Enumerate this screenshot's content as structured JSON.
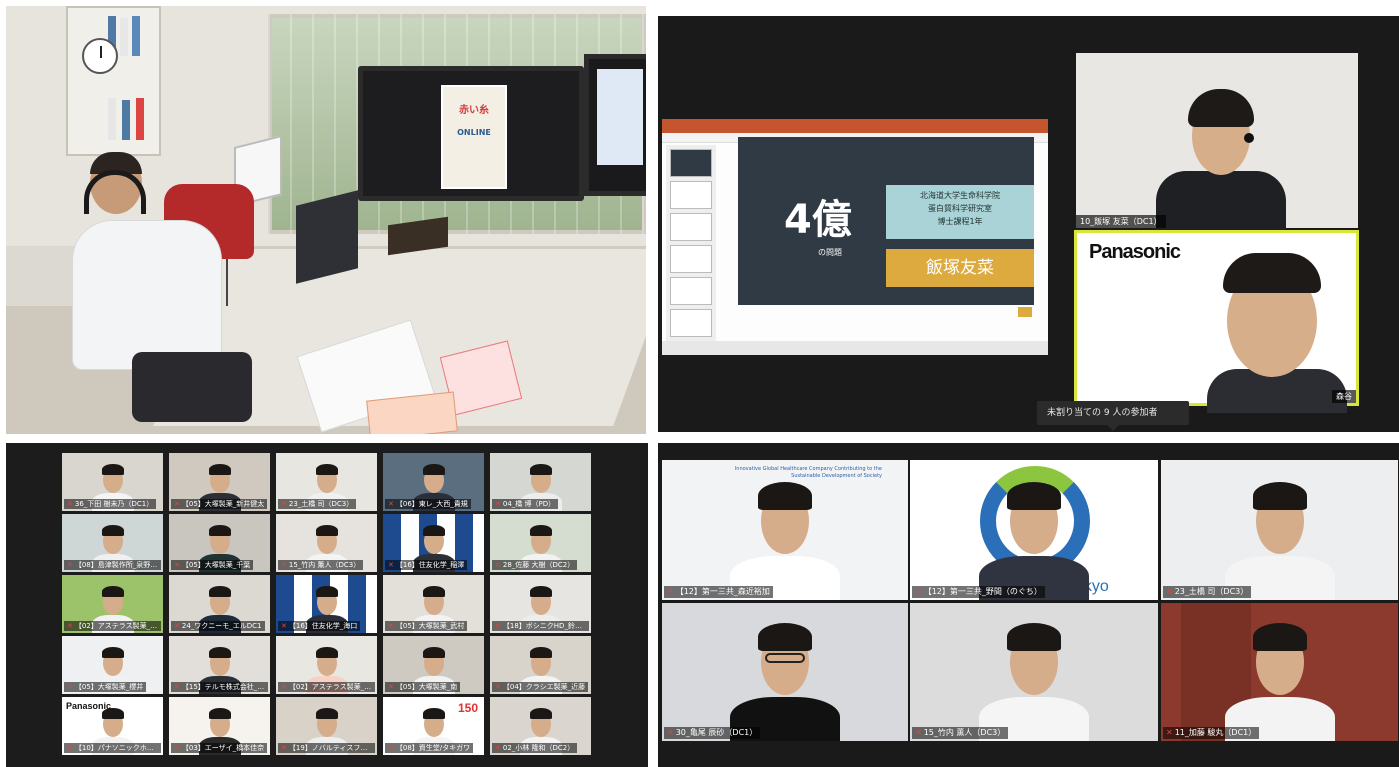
{
  "photo": {
    "poster_title": "赤い糸",
    "poster_sub": "ONLINE"
  },
  "meeting": {
    "slide": {
      "big_number": "4億",
      "big_unit": "",
      "subtitle": "の問題",
      "affiliation_lines": [
        "北海道大学生命科学院",
        "蛋白質科学研究室",
        "博士課程1年"
      ],
      "presenter": "飯塚友菜"
    },
    "video_tiles": [
      {
        "name_label": "10_飯塚 友菜（DC1）"
      },
      {
        "name_label": "森谷",
        "logo": "Panasonic"
      }
    ],
    "tooltip": "未割り当ての 9 人の参加者"
  },
  "grid_small": {
    "tiles": [
      {
        "label": "36_下田 樹未乃（DC1）"
      },
      {
        "label": "【05】大塚製薬_新井健太"
      },
      {
        "label": "23_土橋 司（DC3）"
      },
      {
        "label": "【06】東レ_大西_貴規"
      },
      {
        "label": "04_橋 博（PD）"
      },
      {
        "label": "【08】島津製作所_泉野美聡"
      },
      {
        "label": "【05】大塚製薬_千葉"
      },
      {
        "label": "15_竹内 薫人（DC3）"
      },
      {
        "label": "【16】住友化学_稲澤"
      },
      {
        "label": "28_佐藤 大樹（DC2）"
      },
      {
        "label": "【02】アステラス製薬_菅野"
      },
      {
        "label": "24_ワクニーモ_エルDC1"
      },
      {
        "label": "【16】住友化学_海口"
      },
      {
        "label": "【05】大塚製薬_武村"
      },
      {
        "label": "【18】ボシニクHD_鈴木 正明"
      },
      {
        "label": "【05】大塚製薬_櫻井"
      },
      {
        "label": "【15】テルモ株式会社_水田"
      },
      {
        "label": "【02】アステラス製薬_北田"
      },
      {
        "label": "【05】大塚製薬_南"
      },
      {
        "label": "【04】クラシエ製薬_近藤"
      },
      {
        "label": "【10】パナソニックホールディングス..."
      },
      {
        "label": "【03】エーザイ_橋本佳奈"
      },
      {
        "label": "【19】ノバルティスファーマ_NPKK_S..."
      },
      {
        "label": "【08】資生堂/タキガワ"
      },
      {
        "label": "02_小林 隆和（DC2）"
      }
    ],
    "logos": {
      "panasonic": "Panasonic",
      "shiseido": "150"
    }
  },
  "grid_large": {
    "tiles": [
      {
        "label": "【12】第一三共_森近裕加",
        "banner": "Innovative Global Healthcare Company Contributing to the Sustainable Development of Society"
      },
      {
        "label": "【12】第一三共_野間（のぐち）",
        "brand": "Daiichi-Sankyo"
      },
      {
        "label": "23_土橋 司（DC3）"
      },
      {
        "label": "30_亀尾 辰砂（DC1）"
      },
      {
        "label": "15_竹内 薫人（DC3）"
      },
      {
        "label": "11_加藤 駿丸（DC1）"
      }
    ]
  },
  "colors": {
    "highlight": "#d8e63a",
    "ppt_accent": "#c5552e",
    "slide_teal": "#a9d3d6",
    "slide_gold": "#dcaa3f"
  }
}
